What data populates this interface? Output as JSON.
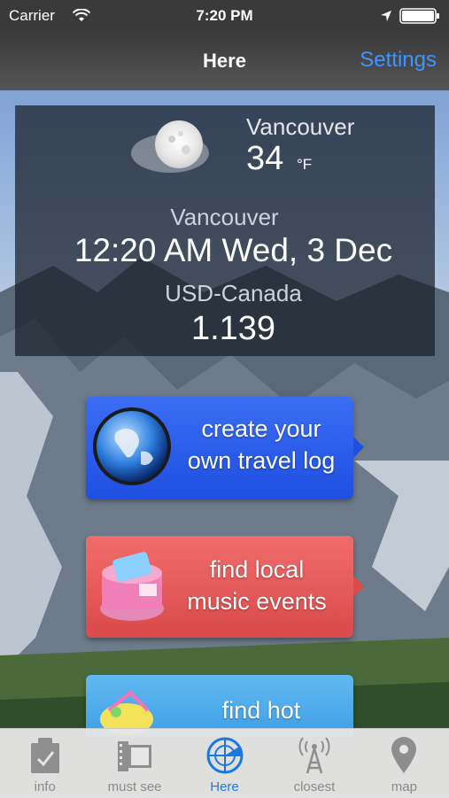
{
  "status": {
    "carrier": "Carrier",
    "time": "7:20 PM"
  },
  "nav": {
    "title": "Here",
    "settings": "Settings"
  },
  "weather": {
    "city": "Vancouver",
    "temperature": "34",
    "unit": "°F"
  },
  "clock": {
    "city": "Vancouver",
    "datetime": "12:20 AM Wed, 3 Dec"
  },
  "currency": {
    "pair": "USD-Canada",
    "rate": "1.139"
  },
  "features": [
    {
      "line1": "create your",
      "line2": "own travel log",
      "icon": "globe-icon"
    },
    {
      "line1": "find local",
      "line2": "music events",
      "icon": "ticket-box-icon"
    },
    {
      "line1": "find hot",
      "line2": "",
      "icon": "cocktail-icon"
    }
  ],
  "tabs": [
    {
      "label": "info",
      "icon": "clipboard-icon"
    },
    {
      "label": "must see",
      "icon": "film-icon"
    },
    {
      "label": "Here",
      "icon": "radar-icon",
      "active": true
    },
    {
      "label": "closest",
      "icon": "antenna-icon"
    },
    {
      "label": "map",
      "icon": "map-pin-icon"
    }
  ],
  "colors": {
    "accent": "#1a78e6",
    "settings": "#3d95ff",
    "blue_button": "#1e4fe0",
    "red_button": "#d94a4a",
    "light_blue_button": "#3f9fe6"
  }
}
